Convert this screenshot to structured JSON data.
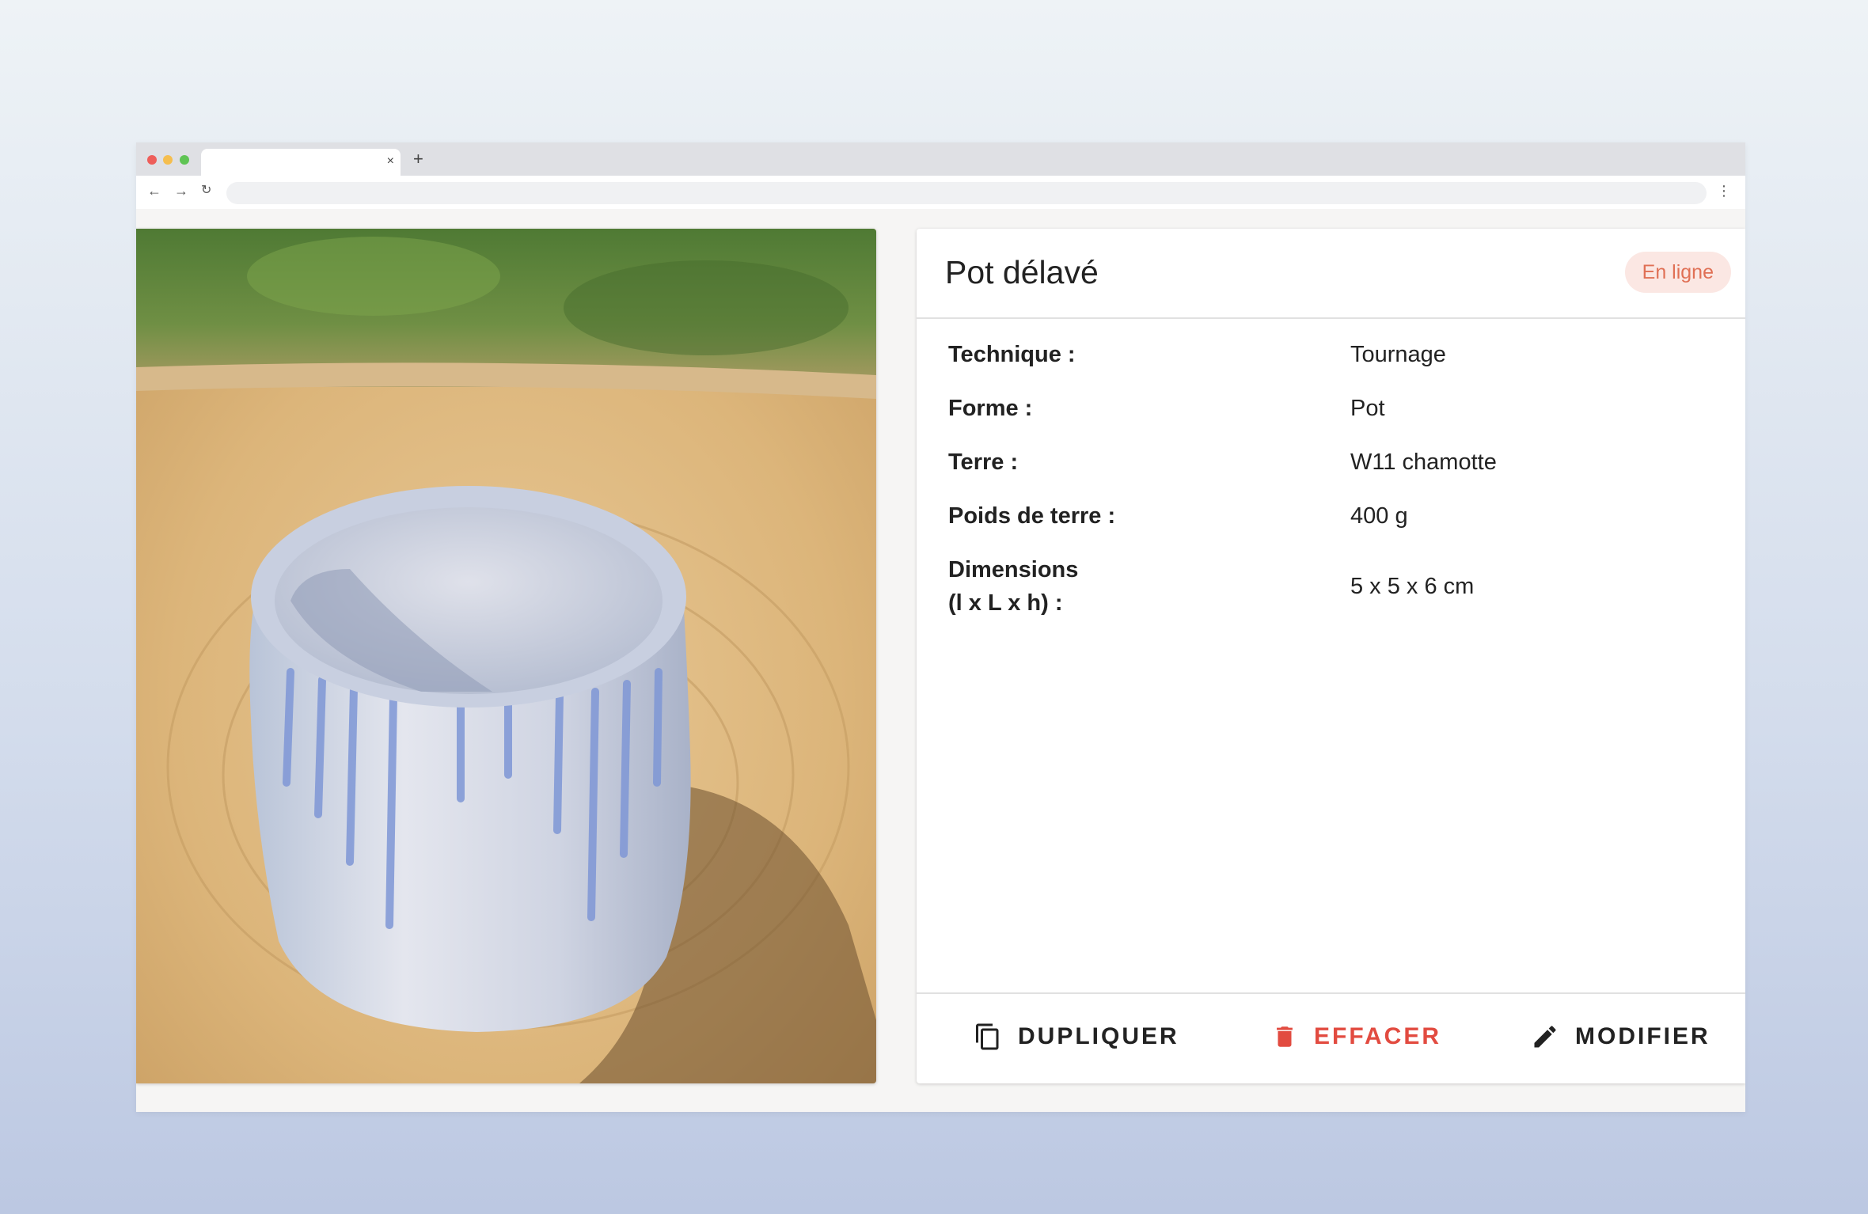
{
  "browser": {
    "tab_close": "×",
    "new_tab": "+",
    "back": "←",
    "forward": "→",
    "reload": "↻",
    "menu": "⋮"
  },
  "product": {
    "title": "Pot délavé",
    "status": "En ligne",
    "details": [
      {
        "label": "Technique :",
        "value": "Tournage"
      },
      {
        "label": "Forme :",
        "value": "Pot"
      },
      {
        "label": "Terre :",
        "value": "W11 chamotte"
      },
      {
        "label": "Poids de terre :",
        "value": "400 g"
      },
      {
        "label_line1": "Dimensions",
        "label_line2": "(l x L x h) :",
        "value": "5 x 5 x 6 cm"
      }
    ]
  },
  "actions": {
    "duplicate": "DUPLIQUER",
    "delete": "EFFACER",
    "edit": "MODIFIER"
  },
  "colors": {
    "status_bg": "#fbe7e3",
    "status_text": "#e07055",
    "delete": "#e24b40"
  },
  "icons": {
    "duplicate": "copy-icon",
    "delete": "trash-icon",
    "edit": "pencil-icon"
  }
}
